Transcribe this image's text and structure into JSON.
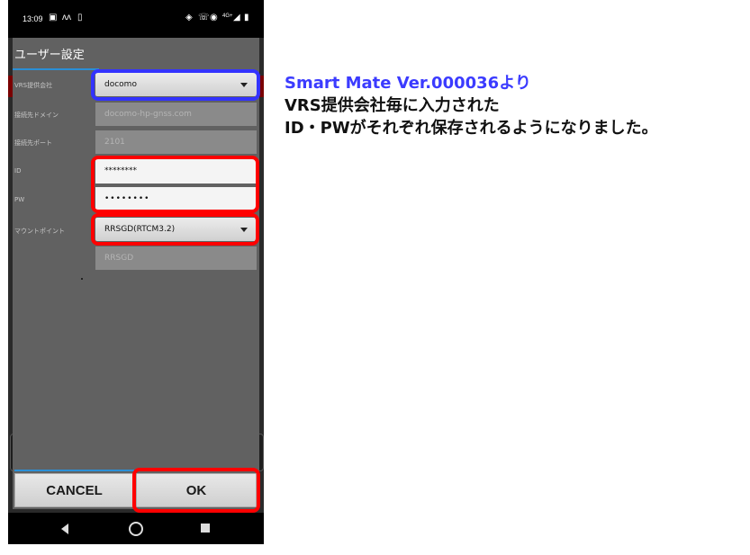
{
  "status_bar": {
    "time": "13:09",
    "left_icons": [
      "image-icon",
      "activity-icon",
      "phone-link-icon"
    ],
    "right_icons": [
      "vibrate-icon",
      "volte-icon",
      "hotspot-icon",
      "4g-signal-icon",
      "battery-icon"
    ],
    "network_label": "4G+"
  },
  "dialog": {
    "title": "ユーザー設定",
    "fields": [
      {
        "label": "VRS提供会社",
        "value": "docomo",
        "type": "select"
      },
      {
        "label": "接続先ドメイン",
        "value": "docomo-hp-gnss.com",
        "type": "readonly"
      },
      {
        "label": "接続先ポート",
        "value": "2101",
        "type": "readonly"
      },
      {
        "label": "ID",
        "value": "********",
        "type": "text"
      },
      {
        "label": "PW",
        "value": "••••••••",
        "type": "password"
      },
      {
        "label": "マウントポイント",
        "value": "RRSGD(RTCM3.2)",
        "type": "select"
      },
      {
        "label": "",
        "value": "RRSGD",
        "type": "readonly"
      }
    ],
    "cancel_label": "CANCEL",
    "ok_label": "OK"
  },
  "highlight_colors": {
    "blue": "#3333ff",
    "red": "#ff0000"
  },
  "annotation": {
    "line1": "Smart Mate Ver.000036より",
    "line2": "VRS提供会社毎に入力された",
    "line3": "ID・PWがそれぞれ保存されるようになりました。",
    "line1_color": "#3b3bff",
    "text_color": "#111111"
  }
}
